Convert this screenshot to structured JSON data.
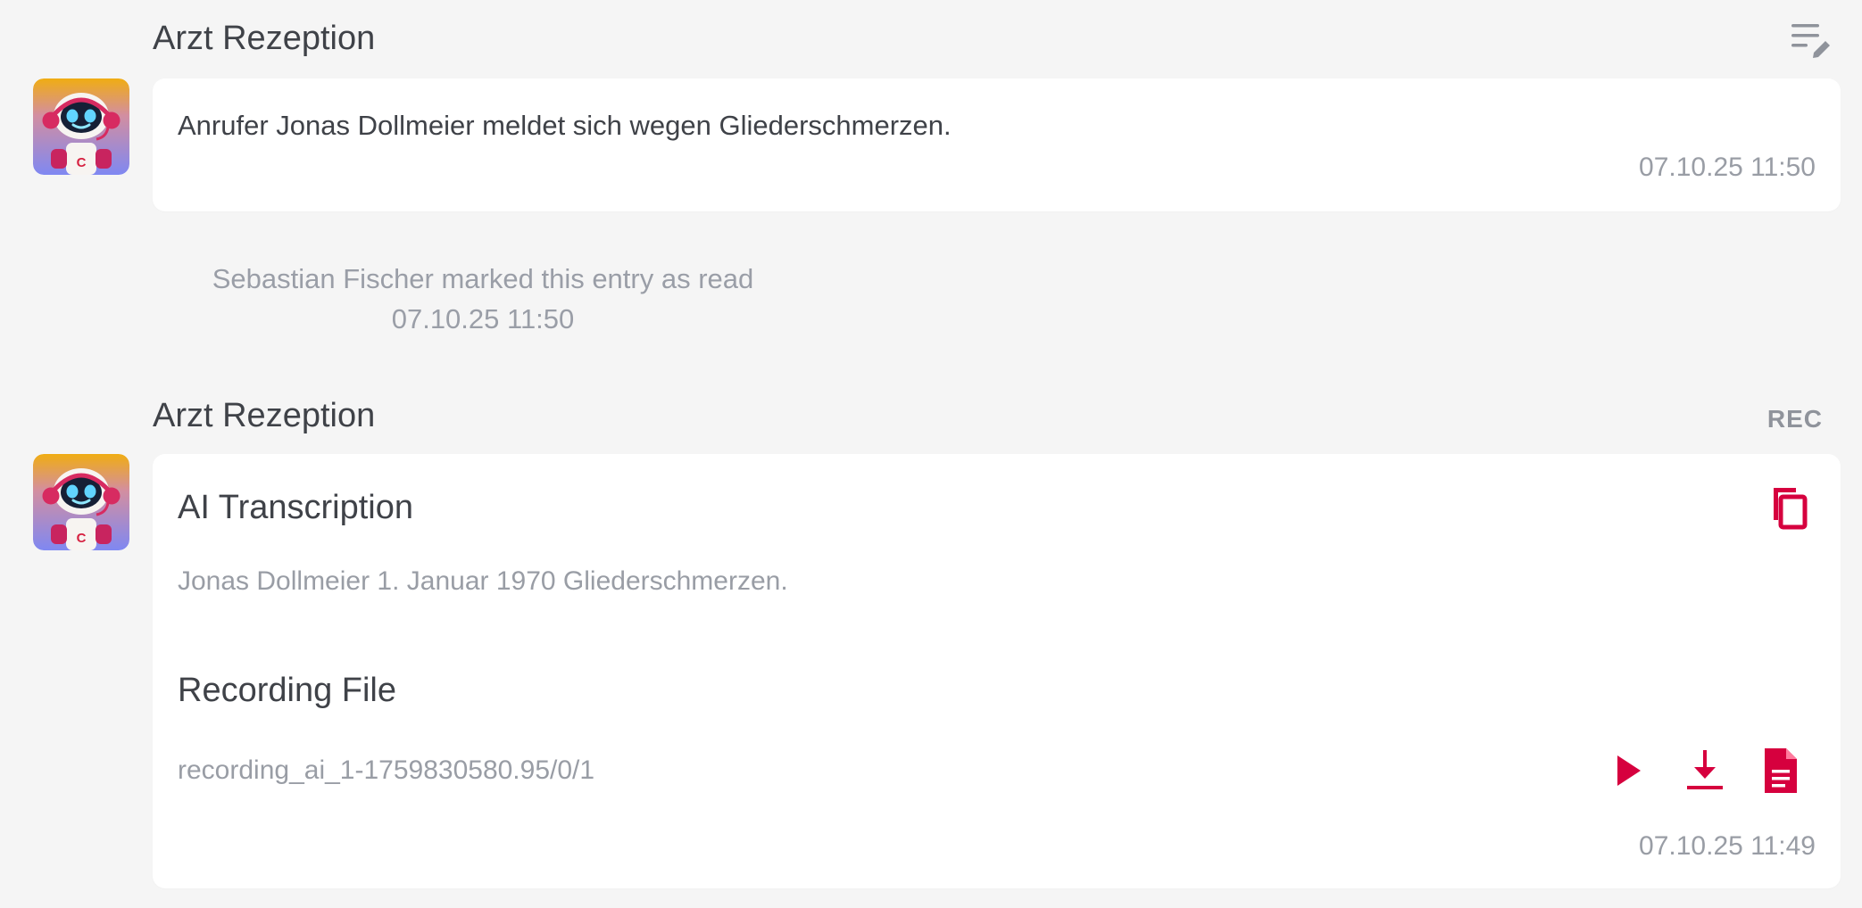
{
  "messages": [
    {
      "sender": "Arzt Rezeption",
      "text": "Anrufer Jonas Dollmeier meldet sich wegen Gliederschmerzen.",
      "timestamp": "07.10.25 11:50"
    },
    {
      "sender": "Arzt Rezeption",
      "tag": "REC",
      "transcription": {
        "title": "AI Transcription",
        "text": "Jonas Dollmeier 1. Januar 1970 Gliederschmerzen."
      },
      "recording": {
        "title": "Recording File",
        "filename": "recording_ai_1-1759830580.95/0/1"
      },
      "timestamp": "07.10.25 11:49"
    }
  ],
  "read_notice": {
    "text": "Sebastian Fischer marked this entry as read",
    "timestamp": "07.10.25 11:50"
  },
  "icons": {
    "header": "edit-notes-icon",
    "copy": "copy-icon",
    "play": "play-icon",
    "download": "download-icon",
    "document": "document-icon",
    "avatar": "robot-avatar-icon"
  },
  "colors": {
    "accent": "#d6003e",
    "background": "#f5f5f5",
    "card": "#ffffff",
    "muted": "#999da5"
  }
}
